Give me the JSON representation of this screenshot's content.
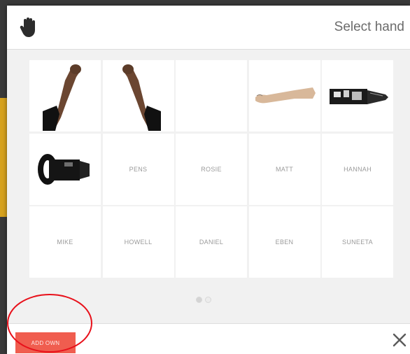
{
  "header": {
    "icon": "hand-icon",
    "title": "Select hand"
  },
  "grid": {
    "cells": [
      {
        "label": "",
        "image": "left-arm-fist"
      },
      {
        "label": "",
        "image": "right-arm-fist"
      },
      {
        "label": "",
        "image": ""
      },
      {
        "label": "",
        "image": "forearm-horizontal"
      },
      {
        "label": "",
        "image": "prosthetic-hand-horizontal"
      },
      {
        "label": "",
        "image": "prosthetic-socket"
      },
      {
        "label": "PENS",
        "image": ""
      },
      {
        "label": "ROSIE",
        "image": ""
      },
      {
        "label": "MATT",
        "image": ""
      },
      {
        "label": "HANNAH",
        "image": ""
      },
      {
        "label": "MIKE",
        "image": ""
      },
      {
        "label": "HOWELL",
        "image": ""
      },
      {
        "label": "DANIEL",
        "image": ""
      },
      {
        "label": "EBEN",
        "image": ""
      },
      {
        "label": "SUNEETA",
        "image": ""
      }
    ]
  },
  "pager": {
    "pages": 2,
    "current": 1
  },
  "footer": {
    "add_own_label": "ADD OWN",
    "close_icon": "close-icon"
  },
  "colors": {
    "accent": "#f05d4f",
    "annotation": "#e8101a"
  }
}
